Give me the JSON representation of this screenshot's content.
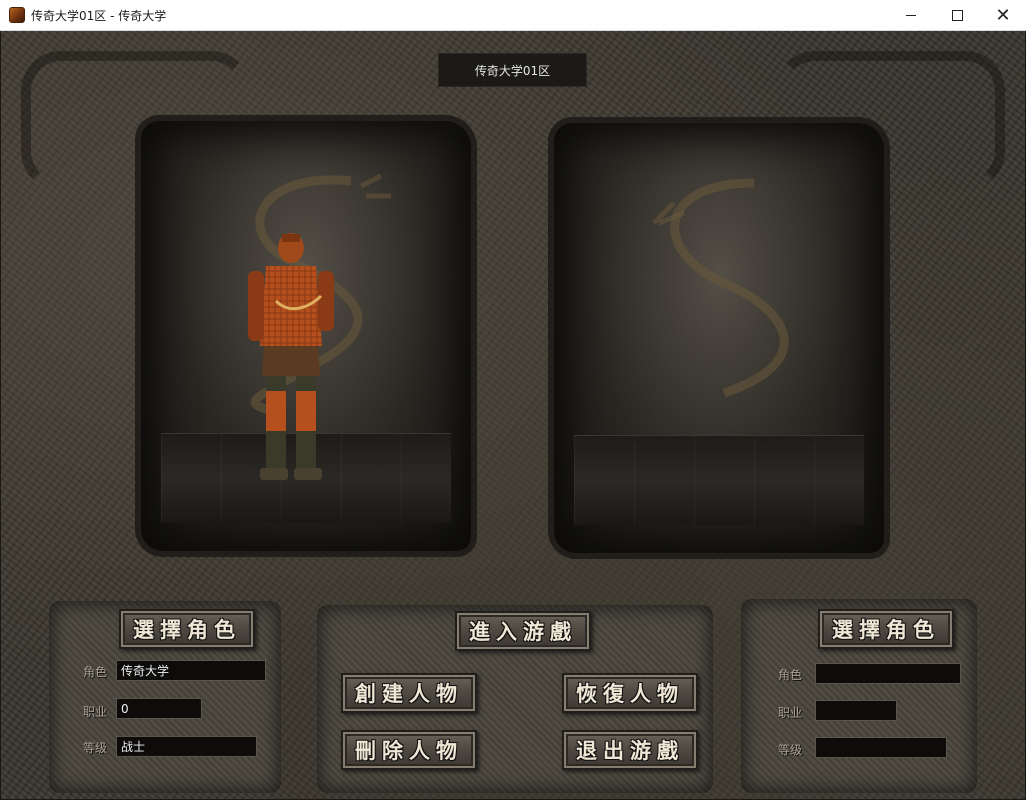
{
  "window": {
    "title": "传奇大学01区 - 传奇大学",
    "min_label": "",
    "max_label": "",
    "close_label": "✕"
  },
  "server_name": "传奇大学01区",
  "left_slot": {
    "select_label": "選擇角色",
    "role_label": "角色",
    "job_label": "职业",
    "level_label": "等级",
    "role_value": "传奇大学",
    "job_value": "0",
    "level_value": "战士"
  },
  "right_slot": {
    "select_label": "選擇角色",
    "role_label": "角色",
    "job_label": "职业",
    "level_label": "等级",
    "role_value": "",
    "job_value": "",
    "level_value": ""
  },
  "actions": {
    "enter_game": "進入游戲",
    "create_char": "創建人物",
    "restore_char": "恢復人物",
    "delete_char": "刪除人物",
    "exit_game": "退出游戲"
  }
}
